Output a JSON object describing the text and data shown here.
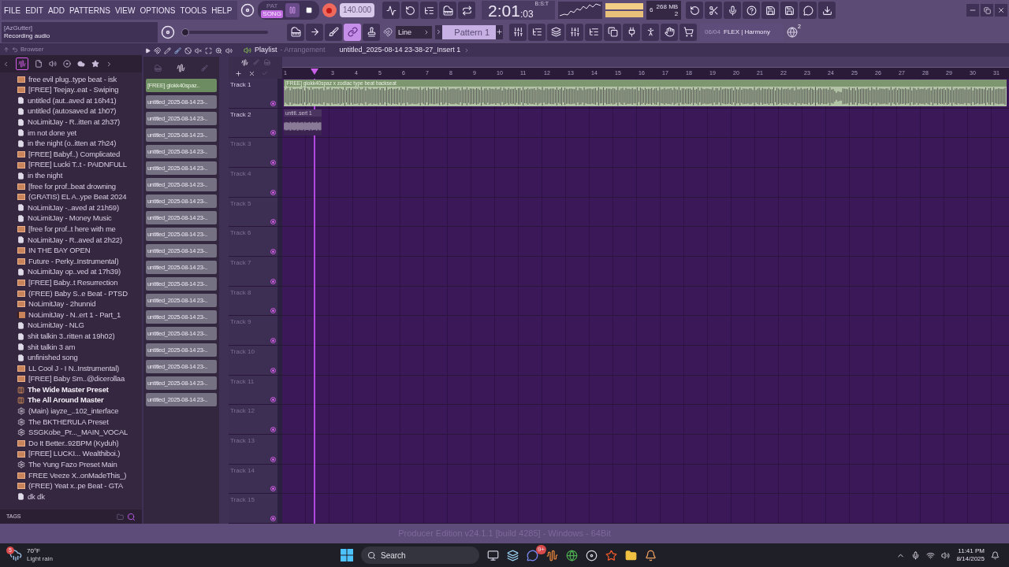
{
  "menu": [
    "FILE",
    "EDIT",
    "ADD",
    "PATTERNS",
    "VIEW",
    "OPTIONS",
    "TOOLS",
    "HELP"
  ],
  "transport": {
    "modes": [
      {
        "label": "PAT",
        "selected": false
      },
      {
        "label": "SONG",
        "selected": true
      }
    ],
    "record_armed": true,
    "tempo": "140.000",
    "time_main": "2:01",
    "time_sub": ":03",
    "time_format": "B:S:T",
    "cpu": "6",
    "memory": "268 MB",
    "polyphony": "2"
  },
  "hint": {
    "title": "[AzGutter]",
    "text": "Recording audio"
  },
  "master_pitch": {
    "level": 0.0
  },
  "toolbar": {
    "link_on": true,
    "snap": "Line",
    "pattern": "Pattern 1",
    "news_date": "06/04",
    "news_text": "FLEX | Harmony",
    "news_badge": "2"
  },
  "browser": {
    "title": "Browser",
    "items": [
      {
        "label": "free evil plug..type beat - isk",
        "kind": "audio"
      },
      {
        "label": "[FREE] Teejay..eat - Swiping",
        "kind": "audio"
      },
      {
        "label": "untitled (aut..aved at 16h41)",
        "kind": "project"
      },
      {
        "label": "untitled (autosaved at 1h07)",
        "kind": "project"
      },
      {
        "label": "NoLimitJay - R..itten at 2h37)",
        "kind": "project"
      },
      {
        "label": "im not done yet",
        "kind": "project"
      },
      {
        "label": "in the night (o..itten at 7h24)",
        "kind": "project"
      },
      {
        "label": "[FREE] Babyf..) Complicated",
        "kind": "audio"
      },
      {
        "label": "[FREE] Lucki T..t - PAIDNFULL",
        "kind": "audio"
      },
      {
        "label": "in the night",
        "kind": "project"
      },
      {
        "label": "[free for prof..beat drowning",
        "kind": "audio"
      },
      {
        "label": "(GRATIS) EL A..ype Beat 2024",
        "kind": "audio"
      },
      {
        "label": "NoLimitJay -..aved at 21h59)",
        "kind": "project"
      },
      {
        "label": "NoLimitJay - Money Music",
        "kind": "project"
      },
      {
        "label": "[free for prof..t here with me",
        "kind": "audio"
      },
      {
        "label": "NoLimitJay - R..aved at 2h22)",
        "kind": "project"
      },
      {
        "label": "IN THE BAY OPEN",
        "kind": "audio"
      },
      {
        "label": "Future - Perky..Instrumental)",
        "kind": "audio"
      },
      {
        "label": "NoLimitJay op..ved at 17h39)",
        "kind": "project"
      },
      {
        "label": "[FREE] Baby..t Resurrection",
        "kind": "audio"
      },
      {
        "label": "(FREE) Baby S..e Beat - PTSD",
        "kind": "audio"
      },
      {
        "label": "NoLimitJay - 2hunnid",
        "kind": "audio"
      },
      {
        "label": "NoLimitJay - N..ert 1 - Part_1",
        "kind": "clip"
      },
      {
        "label": "NoLimitJay - NLG",
        "kind": "project"
      },
      {
        "label": "shit talkin 3..ritten at 19h02)",
        "kind": "project"
      },
      {
        "label": "shit talkin 3 am",
        "kind": "project"
      },
      {
        "label": "unfinished song",
        "kind": "project"
      },
      {
        "label": "LL Cool J - I N..Instrumental)",
        "kind": "audio"
      },
      {
        "label": "[FREE] Baby Sm..@dicerollaa",
        "kind": "audio"
      },
      {
        "label": "The Wide Master Preset",
        "kind": "master"
      },
      {
        "label": "The All Around Master",
        "kind": "master"
      },
      {
        "label": "(Main) iayze_..102_interface",
        "kind": "preset"
      },
      {
        "label": "The BKTHERULA Preset",
        "kind": "preset"
      },
      {
        "label": "SSGKobe_Pr..._MAIN_VOCAL",
        "kind": "preset"
      },
      {
        "label": "Do It Better..92BPM (Kyduh)",
        "kind": "audio"
      },
      {
        "label": "[FREE] LUCKI... Wealthiboi.)",
        "kind": "audio"
      },
      {
        "label": "The Yung Fazo Preset Main",
        "kind": "preset"
      },
      {
        "label": "FREE Veeze X..onMadeThis_)",
        "kind": "audio"
      },
      {
        "label": "(FREE) Yeat x..pe Beat - GTA",
        "kind": "audio"
      },
      {
        "label": "dk dk",
        "kind": "project"
      }
    ],
    "tags": "TAGS"
  },
  "playlist": {
    "title": "Playlist",
    "subtitle": "- Arrangement",
    "breadcrumb": "untitled_2025-08-14 23-38-27_Insert 1",
    "clips": [
      {
        "label": "[FREE] glokk40spaz..",
        "selected": true
      },
      {
        "label": "untitled_2025-08-14 23-..",
        "selected": false
      },
      {
        "label": "untitled_2025-08-14 23-..",
        "selected": false
      },
      {
        "label": "untitled_2025-08-14 23-..",
        "selected": false
      },
      {
        "label": "untitled_2025-08-14 23-..",
        "selected": false
      },
      {
        "label": "untitled_2025-08-14 23-..",
        "selected": false
      },
      {
        "label": "untitled_2025-08-14 23-..",
        "selected": false
      },
      {
        "label": "untitled_2025-08-14 23-..",
        "selected": false
      },
      {
        "label": "untitled_2025-08-14 23-..",
        "selected": false
      },
      {
        "label": "untitled_2025-08-14 23-..",
        "selected": false
      },
      {
        "label": "untitled_2025-08-14 23-..",
        "selected": false
      },
      {
        "label": "untitled_2025-08-14 23-..",
        "selected": false
      },
      {
        "label": "untitled_2025-08-14 23-..",
        "selected": false
      },
      {
        "label": "untitled_2025-08-14 23-..",
        "selected": false
      },
      {
        "label": "untitled_2025-08-14 23-..",
        "selected": false
      },
      {
        "label": "untitled_2025-08-14 23-..",
        "selected": false
      },
      {
        "label": "untitled_2025-08-14 23-..",
        "selected": false
      },
      {
        "label": "untitled_2025-08-14 23-..",
        "selected": false
      },
      {
        "label": "untitled_2025-08-14 23-..",
        "selected": false
      },
      {
        "label": "untitled_2025-08-14 23-..",
        "selected": false
      }
    ],
    "ruler": [
      "1",
      "3",
      "4",
      "5",
      "6",
      "7",
      "8",
      "9",
      "10",
      "11",
      "12",
      "13",
      "14",
      "15",
      "16",
      "17",
      "18",
      "19",
      "20",
      "21",
      "22",
      "23",
      "24",
      "25",
      "26",
      "27",
      "28",
      "29",
      "30",
      "31"
    ],
    "tracks": [
      {
        "label": "Track 1",
        "dimmed": false,
        "clip": {
          "label": "[FREE] glokk40spaz x zodiac type beat backseat",
          "kind": "long"
        }
      },
      {
        "label": "Track 2",
        "dimmed": false,
        "clip": {
          "label": "untitl..sert 1",
          "kind": "short"
        }
      },
      {
        "label": "Track 3",
        "dimmed": true
      },
      {
        "label": "Track 4",
        "dimmed": true
      },
      {
        "label": "Track 5",
        "dimmed": true
      },
      {
        "label": "Track 6",
        "dimmed": true
      },
      {
        "label": "Track 7",
        "dimmed": true
      },
      {
        "label": "Track 8",
        "dimmed": true
      },
      {
        "label": "Track 9",
        "dimmed": true
      },
      {
        "label": "Track 10",
        "dimmed": true
      },
      {
        "label": "Track 11",
        "dimmed": true
      },
      {
        "label": "Track 12",
        "dimmed": true
      },
      {
        "label": "Track 13",
        "dimmed": true
      },
      {
        "label": "Track 14",
        "dimmed": true
      },
      {
        "label": "Track 15",
        "dimmed": true
      }
    ]
  },
  "status_bar": "Producer Edition v24.1.1 [build 4285] - Windows - 64Bit",
  "taskbar": {
    "weather_badge": "5",
    "temperature": "70°F",
    "weather": "Light rain",
    "search": "Search",
    "chat_badge": "9+",
    "time": "11:41 PM",
    "date": "8/14/2025"
  }
}
